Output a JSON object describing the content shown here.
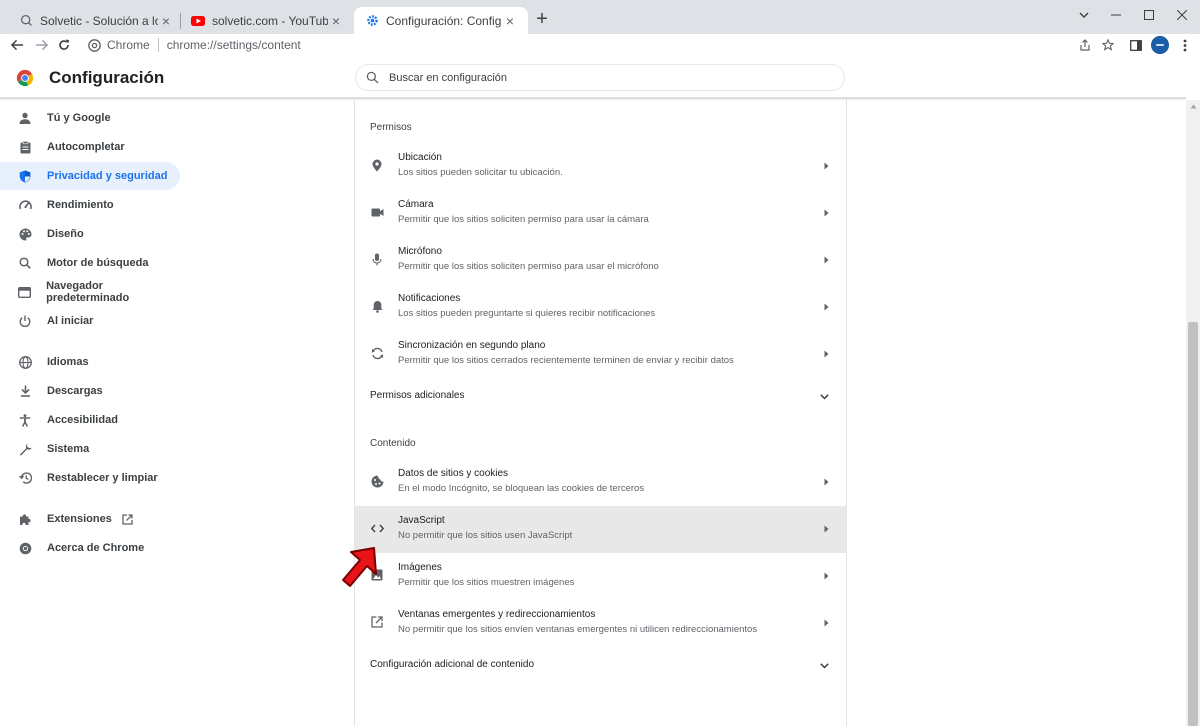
{
  "browser": {
    "tabs": [
      {
        "title": "Solvetic - Solución a los problem",
        "icon": "search-icon"
      },
      {
        "title": "solvetic.com - YouTube",
        "icon": "youtube-icon"
      },
      {
        "title": "Configuración: Configuración de",
        "icon": "gear-icon",
        "active": true
      }
    ],
    "omnibox": {
      "chip_label": "Chrome",
      "url": "chrome://settings/content"
    }
  },
  "header": {
    "title": "Configuración",
    "search_placeholder": "Buscar en configuración"
  },
  "sidebar": {
    "items": [
      {
        "label": "Tú y Google",
        "icon": "person-icon"
      },
      {
        "label": "Autocompletar",
        "icon": "clipboard-icon"
      },
      {
        "label": "Privacidad y seguridad",
        "icon": "shield-icon",
        "active": true
      },
      {
        "label": "Rendimiento",
        "icon": "speedometer-icon"
      },
      {
        "label": "Diseño",
        "icon": "palette-icon"
      },
      {
        "label": "Motor de búsqueda",
        "icon": "search-icon"
      },
      {
        "label": "Navegador predeterminado",
        "icon": "browser-icon"
      },
      {
        "label": "Al iniciar",
        "icon": "power-icon"
      },
      {
        "label": "Idiomas",
        "icon": "globe-icon"
      },
      {
        "label": "Descargas",
        "icon": "download-icon"
      },
      {
        "label": "Accesibilidad",
        "icon": "accessibility-icon"
      },
      {
        "label": "Sistema",
        "icon": "wrench-icon"
      },
      {
        "label": "Restablecer y limpiar",
        "icon": "history-icon"
      },
      {
        "label": "Extensiones",
        "icon": "puzzle-icon"
      },
      {
        "label": "Acerca de Chrome",
        "icon": "chrome-icon"
      }
    ]
  },
  "main": {
    "permisos_title": "Permisos",
    "permisos": [
      {
        "title": "Ubicación",
        "subtitle": "Los sitios pueden solicitar tu ubicación.",
        "icon": "location-icon"
      },
      {
        "title": "Cámara",
        "subtitle": "Permitir que los sitios soliciten permiso para usar la cámara",
        "icon": "camera-icon"
      },
      {
        "title": "Micrófono",
        "subtitle": "Permitir que los sitios soliciten permiso para usar el micrófono",
        "icon": "microphone-icon"
      },
      {
        "title": "Notificaciones",
        "subtitle": "Los sitios pueden preguntarte si quieres recibir notificaciones",
        "icon": "bell-icon"
      },
      {
        "title": "Sincronización en segundo plano",
        "subtitle": "Permitir que los sitios cerrados recientemente terminen de enviar y recibir datos",
        "icon": "sync-icon"
      }
    ],
    "permisos_adicionales": "Permisos adicionales",
    "contenido_title": "Contenido",
    "contenido": [
      {
        "title": "Datos de sitios y cookies",
        "subtitle": "En el modo Incógnito, se bloquean las cookies de terceros",
        "icon": "cookie-icon"
      },
      {
        "title": "JavaScript",
        "subtitle": "No permitir que los sitios usen JavaScript",
        "icon": "code-icon",
        "highlighted": true
      },
      {
        "title": "Imágenes",
        "subtitle": "Permitir que los sitios muestren imágenes",
        "icon": "image-icon"
      },
      {
        "title": "Ventanas emergentes y redireccionamientos",
        "subtitle": "No permitir que los sitios envíen ventanas emergentes ni utilicen redireccionamientos",
        "icon": "open-in-new-icon"
      }
    ],
    "config_adicional": "Configuración adicional de contenido"
  },
  "colors": {
    "accent": "#1a73e8",
    "active_bg": "#e8f0fe",
    "annotation_arrow": "#e8141a"
  }
}
